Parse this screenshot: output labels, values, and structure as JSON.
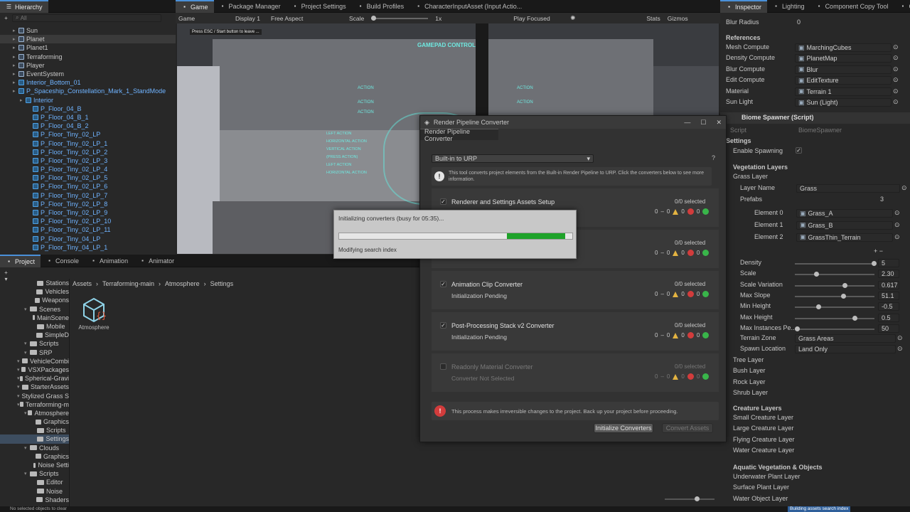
{
  "hierarchy": {
    "tab": "Hierarchy",
    "search_placeholder": "All",
    "items": [
      {
        "label": "Sun",
        "indent": 1,
        "blue": false
      },
      {
        "label": "Planet",
        "indent": 1,
        "blue": false
      },
      {
        "label": "Planet1",
        "indent": 1,
        "blue": false
      },
      {
        "label": "Terraforming",
        "indent": 1,
        "blue": false
      },
      {
        "label": "Player",
        "indent": 1,
        "blue": false
      },
      {
        "label": "EventSystem",
        "indent": 1,
        "blue": false
      },
      {
        "label": "Interior_Bottom_01",
        "indent": 1,
        "blue": true
      },
      {
        "label": "P_Spaceship_Constellation_Mark_1_StandMode",
        "indent": 1,
        "blue": true
      },
      {
        "label": "Interior",
        "indent": 2,
        "blue": true
      },
      {
        "label": "P_Floor_04_B",
        "indent": 3,
        "blue": true
      },
      {
        "label": "P_Floor_04_B_1",
        "indent": 3,
        "blue": true
      },
      {
        "label": "P_Floor_04_B_2",
        "indent": 3,
        "blue": true
      },
      {
        "label": "P_Floor_Tiny_02_LP",
        "indent": 3,
        "blue": true
      },
      {
        "label": "P_Floor_Tiny_02_LP_1",
        "indent": 3,
        "blue": true
      },
      {
        "label": "P_Floor_Tiny_02_LP_2",
        "indent": 3,
        "blue": true
      },
      {
        "label": "P_Floor_Tiny_02_LP_3",
        "indent": 3,
        "blue": true
      },
      {
        "label": "P_Floor_Tiny_02_LP_4",
        "indent": 3,
        "blue": true
      },
      {
        "label": "P_Floor_Tiny_02_LP_5",
        "indent": 3,
        "blue": true
      },
      {
        "label": "P_Floor_Tiny_02_LP_6",
        "indent": 3,
        "blue": true
      },
      {
        "label": "P_Floor_Tiny_02_LP_7",
        "indent": 3,
        "blue": true
      },
      {
        "label": "P_Floor_Tiny_02_LP_8",
        "indent": 3,
        "blue": true
      },
      {
        "label": "P_Floor_Tiny_02_LP_9",
        "indent": 3,
        "blue": true
      },
      {
        "label": "P_Floor_Tiny_02_LP_10",
        "indent": 3,
        "blue": true
      },
      {
        "label": "P_Floor_Tiny_02_LP_11",
        "indent": 3,
        "blue": true
      },
      {
        "label": "P_Floor_Tiny_04_LP",
        "indent": 3,
        "blue": true
      },
      {
        "label": "P_Floor_Tiny_04_LP_1",
        "indent": 3,
        "blue": true
      }
    ]
  },
  "center_tabs": [
    "Game",
    "Package Manager",
    "Project Settings",
    "Build Profiles",
    "CharacterInputAsset (Input Actio..."
  ],
  "game_toolbar": {
    "game": "Game",
    "display": "Display 1",
    "aspect": "Free Aspect",
    "scale_label": "Scale",
    "scale_value": "1x",
    "play_mode": "Play Focused",
    "stats": "Stats",
    "gizmos": "Gizmos"
  },
  "game_view": {
    "overlay_note": "Press ESC / Start button to leave ...",
    "hud_title": "GAMEPAD CONTROLS",
    "hud_actions": [
      "ACTION",
      "ACTION",
      "ACTION",
      "ACTION",
      "ACTION"
    ],
    "hud_left": [
      "LEFT ACTION",
      "HORIZONTAL ACTION",
      "VERTICAL ACTION",
      "(PRESS ACTION)",
      "LEFT ACTION",
      "HORIZONTAL ACTION"
    ]
  },
  "project": {
    "tabs": [
      "Project",
      "Console",
      "Animation",
      "Animator"
    ],
    "breadcrumb": [
      "Assets",
      "Terraforming-main",
      "Atmosphere",
      "Settings"
    ],
    "asset_name": "Atmosphere",
    "tree": [
      {
        "label": "Stations",
        "indent": 3
      },
      {
        "label": "Vehicles",
        "indent": 3
      },
      {
        "label": "Weapons",
        "indent": 3
      },
      {
        "label": "Scenes",
        "indent": 2
      },
      {
        "label": "MainScene",
        "indent": 3
      },
      {
        "label": "Mobile",
        "indent": 3
      },
      {
        "label": "SimpleD",
        "indent": 3
      },
      {
        "label": "Scripts",
        "indent": 2
      },
      {
        "label": "SRP",
        "indent": 2
      },
      {
        "label": "VehicleCombi",
        "indent": 1
      },
      {
        "label": "VSXPackages",
        "indent": 1
      },
      {
        "label": "Spherical-Gravi",
        "indent": 1
      },
      {
        "label": "StarterAssets",
        "indent": 1
      },
      {
        "label": "Stylized Grass S",
        "indent": 1
      },
      {
        "label": "Terraforming-m",
        "indent": 1
      },
      {
        "label": "Atmosphere",
        "indent": 2
      },
      {
        "label": "Graphics",
        "indent": 3
      },
      {
        "label": "Scripts",
        "indent": 3
      },
      {
        "label": "Settings",
        "indent": 3
      },
      {
        "label": "Clouds",
        "indent": 2
      },
      {
        "label": "Graphics",
        "indent": 3
      },
      {
        "label": "Noise Setti",
        "indent": 3
      },
      {
        "label": "Scripts",
        "indent": 2
      },
      {
        "label": "Editor",
        "indent": 3
      },
      {
        "label": "Noise",
        "indent": 3
      },
      {
        "label": "Shaders",
        "indent": 3
      }
    ]
  },
  "rp_converter": {
    "window_title": "Render Pipeline Converter",
    "tab": "Render Pipeline Converter",
    "dropdown": "Built-in to URP",
    "info": "This tool converts project elements from the Built-in Render Pipeline to URP. Click the converters below to see more information.",
    "converters": [
      {
        "name": "Renderer and Settings Assets Setup",
        "status": "",
        "selected": "0/0 selected",
        "warn": "0",
        "err": "0",
        "ok": "0",
        "enabled": true
      },
      {
        "name": "",
        "status": "",
        "selected": "0/0 selected",
        "warn": "0",
        "err": "0",
        "ok": "0",
        "enabled": true
      },
      {
        "name": "Animation Clip Converter",
        "status": "Initialization Pending",
        "selected": "0/0 selected",
        "warn": "0",
        "err": "0",
        "ok": "0",
        "enabled": true
      },
      {
        "name": "Post-Processing Stack v2 Converter",
        "status": "Initialization Pending",
        "selected": "0/0 selected",
        "warn": "0",
        "err": "0",
        "ok": "0",
        "enabled": true
      },
      {
        "name": "Readonly Material Converter",
        "status": "Converter Not Selected",
        "selected": "0/0 selected",
        "warn": "0",
        "err": "0",
        "ok": "0",
        "enabled": false
      }
    ],
    "counts_prefix": "0",
    "warning": "This process makes irreversible changes to the project. Back up your project before proceeding.",
    "init_button": "Initialize Converters",
    "convert_button": "Convert Assets"
  },
  "progress": {
    "title": "Initializing converters (busy for 05:35)...",
    "status": "Modifying search index",
    "fraction": 0.25
  },
  "inspector": {
    "tabs": [
      "Inspector",
      "Lighting",
      "Component Copy Tool",
      "Col"
    ],
    "blur_radius_label": "Blur Radius",
    "blur_radius": "0",
    "references_header": "References",
    "references": [
      {
        "label": "Mesh Compute",
        "value": "MarchingCubes"
      },
      {
        "label": "Density Compute",
        "value": "PlanetMap"
      },
      {
        "label": "Blur Compute",
        "value": "Blur"
      },
      {
        "label": "Edit Compute",
        "value": "EditTexture"
      },
      {
        "label": "Material",
        "value": "Terrain 1"
      },
      {
        "label": "Sun Light",
        "value": "Sun (Light)"
      }
    ],
    "component": "Biome Spawner (Script)",
    "script_label": "Script",
    "script_value": "BiomeSpawner",
    "settings_header": "Settings",
    "enable_spawning": "Enable Spawning",
    "vegetation_layers": "Vegetation Layers",
    "grass_layer": "Grass Layer",
    "layer_name_label": "Layer Name",
    "layer_name": "Grass",
    "prefabs_label": "Prefabs",
    "prefabs_count": "3",
    "elements": [
      {
        "label": "Element 0",
        "value": "Grass_A"
      },
      {
        "label": "Element 1",
        "value": "Grass_B"
      },
      {
        "label": "Element 2",
        "value": "GrassThin_Terrain"
      }
    ],
    "sliders": [
      {
        "label": "Density",
        "value": "5",
        "fraction": 1.0
      },
      {
        "label": "Scale",
        "value": "2.30",
        "fraction": 0.25
      },
      {
        "label": "Scale Variation",
        "value": "0.617",
        "fraction": 0.62
      },
      {
        "label": "Max Slope",
        "value": "51.1",
        "fraction": 0.6
      },
      {
        "label": "Min Height",
        "value": "-0.5",
        "fraction": 0.28
      },
      {
        "label": "Max Height",
        "value": "0.5",
        "fraction": 0.75
      },
      {
        "label": "Max Instances Pe...",
        "value": "50",
        "fraction": 0.0
      }
    ],
    "terrain_zone_label": "Terrain Zone",
    "terrain_zone": "Grass Areas",
    "spawn_location_label": "Spawn Location",
    "spawn_location": "Land Only",
    "layers": [
      "Tree Layer",
      "Bush Layer",
      "Rock Layer",
      "Shrub Layer"
    ],
    "creature_header": "Creature Layers",
    "creature_layers": [
      "Small Creature Layer",
      "Large Creature Layer",
      "Flying Creature Layer",
      "Water Creature Layer"
    ],
    "aquatic_header": "Aquatic Vegetation & Objects",
    "aquatic_layers": [
      "Underwater Plant Layer",
      "Surface Plant Layer",
      "Water Object Layer"
    ]
  },
  "statusbar": {
    "left": "No selected objects to clear",
    "right": "Building assets search index"
  },
  "colors": {
    "accent": "#4a90d9",
    "progress": "#1fa32a",
    "error": "#d23c3c",
    "warning": "#e3b341",
    "ok": "#39b54a"
  }
}
